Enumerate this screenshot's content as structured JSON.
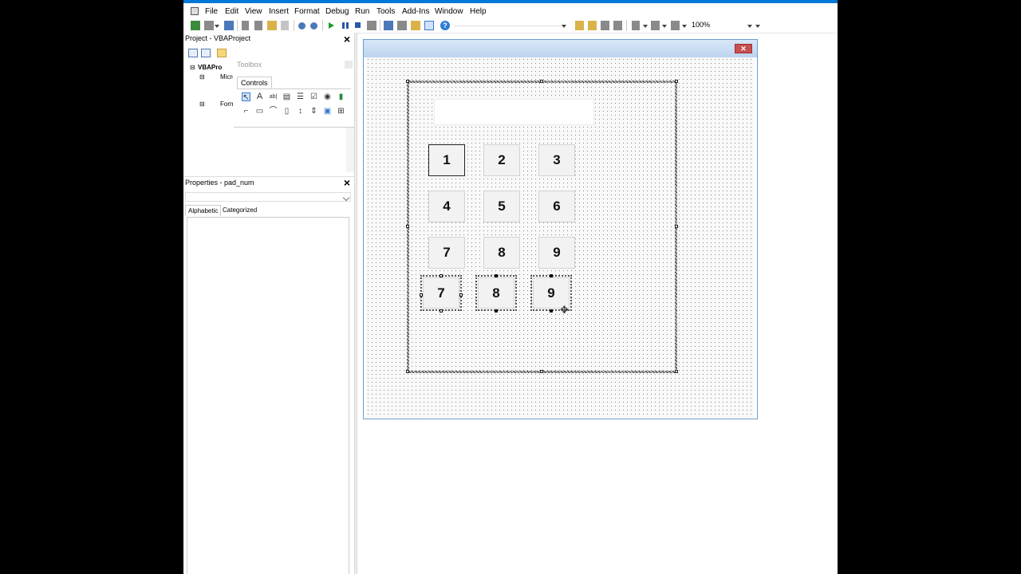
{
  "menu": [
    "File",
    "Edit",
    "View",
    "Insert",
    "Format",
    "Debug",
    "Run",
    "Tools",
    "Add-Ins",
    "Window",
    "Help"
  ],
  "toolbar": {
    "zoom": "100%"
  },
  "project": {
    "title": "Project - VBAProject",
    "tree": [
      "VBAPro",
      "Micro",
      "Form"
    ]
  },
  "toolbox": {
    "title": "Toolbox",
    "tab": "Controls",
    "controls_row1": [
      "select-objects",
      "label",
      "textbox",
      "combobox",
      "listbox",
      "checkbox",
      "optionbutton",
      "togglebutton"
    ],
    "controls_row2": [
      "frame",
      "commandbutton",
      "tabstrip",
      "multipage",
      "scrollbar",
      "spinbutton",
      "image",
      "refedit"
    ]
  },
  "properties": {
    "title": "Properties - pad_num",
    "tabs": [
      "Alphabetic",
      "Categorized"
    ]
  },
  "form": {
    "keys_grid": [
      "1",
      "2",
      "3",
      "4",
      "5",
      "6",
      "7",
      "8",
      "9"
    ],
    "selected_keys": [
      "7",
      "8",
      "9"
    ]
  }
}
